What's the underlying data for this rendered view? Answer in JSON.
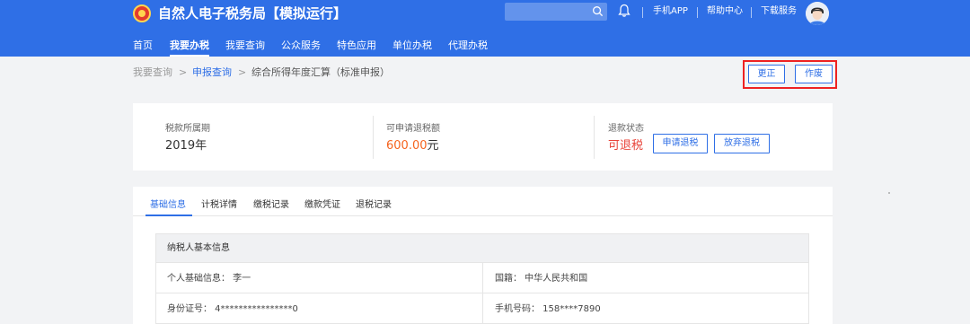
{
  "header": {
    "brand": "自然人电子税务局【模拟运行】",
    "search_placeholder": "",
    "links": [
      "手机APP",
      "帮助中心",
      "下载服务"
    ]
  },
  "nav": {
    "items": [
      "首页",
      "我要办税",
      "我要查询",
      "公众服务",
      "特色应用",
      "单位办税",
      "代理办税"
    ],
    "active_index": 1
  },
  "breadcrumb": {
    "items": [
      "我要查询",
      "申报查询",
      "综合所得年度汇算（标准申报）"
    ],
    "separator": ">"
  },
  "actions": {
    "correct_label": "更正",
    "void_label": "作废"
  },
  "summary": {
    "period_label": "税款所属期",
    "period_value": "2019年",
    "refund_label": "可申请退税额",
    "refund_amount": "600.00",
    "refund_unit": "元",
    "status_label": "退款状态",
    "status_value": "可退税",
    "apply_label": "申请退税",
    "abandon_label": "放弃退税"
  },
  "tabs": [
    "基础信息",
    "计税详情",
    "缴税记录",
    "缴款凭证",
    "退税记录"
  ],
  "taxpayer": {
    "section_title": "纳税人基本信息",
    "rows": [
      {
        "left": "个人基础信息：  李一",
        "right": "国籍：  中华人民共和国"
      },
      {
        "left": "身份证号：  4****************0",
        "right": "手机号码：  158****7890"
      }
    ]
  },
  "colors": {
    "primary": "#2f6fe6",
    "accent_orange": "#f5641e",
    "status_red": "#e8443a",
    "highlight_red": "#ee2222"
  }
}
